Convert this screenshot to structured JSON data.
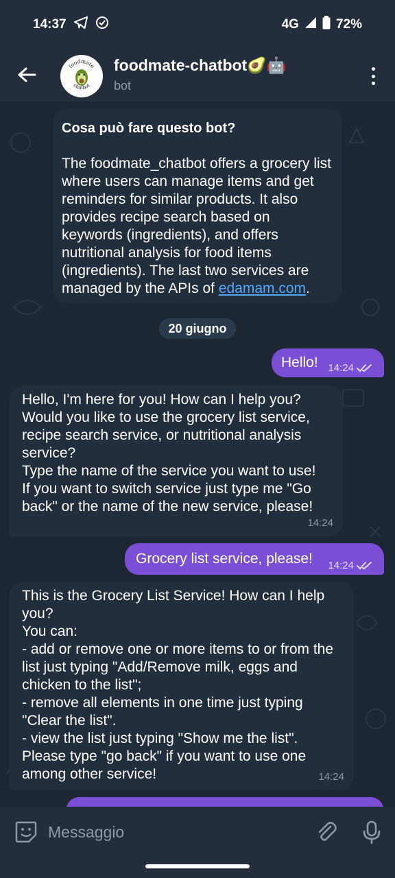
{
  "status_bar": {
    "time": "14:37",
    "network": "4G",
    "battery": "72%",
    "icons": [
      "telegram-icon",
      "check-circle-icon",
      "signal-icon",
      "battery-icon"
    ]
  },
  "header": {
    "title": "foodmate-chatbot🥑🤖",
    "subtitle": "bot",
    "avatar_text_top": "foodmate",
    "avatar_text_bottom": "chatbot"
  },
  "info_card": {
    "title": "Cosa può fare questo bot?",
    "body": "The foodmate_chatbot offers a grocery list where users can manage items and get reminders for similar products. It also provides recipe search based on keywords (ingredients), and offers nutritional analysis for food items (ingredients). The last two services are managed by the APIs of ",
    "link": "edamam.com",
    "after_link": "."
  },
  "date_chip": "20 giugno",
  "messages": [
    {
      "direction": "out",
      "text": "Hello!",
      "time": "14:24"
    },
    {
      "direction": "in",
      "text": "Hello, I'm here for you! How can I help you? Would you like to use the grocery list service, recipe search service, or nutritional analysis service?\nType the name of the service you want to use!\nIf you want to switch service just type me \"Go back\" or the name of the new service, please!",
      "time": "14:24"
    },
    {
      "direction": "out",
      "text": "Grocery list service, please!",
      "time": "14:24"
    },
    {
      "direction": "in",
      "text": "This is the Grocery List Service! How can I help you?\nYou can:\n- add or remove one or more items to or from the list just typing \"Add/Remove milk, eggs and chicken to the list\";\n- remove all elements in one time just typing \"Clear the list\".\n- view the list just typing \"Show me the list\".\nPlease type \"go back\" if you want to use one among other service!",
      "time": "14:24"
    }
  ],
  "input": {
    "placeholder": "Messaggio"
  },
  "colors": {
    "background": "#1d2633",
    "header": "#232d3b",
    "incoming_bubble": "#232e3d",
    "outgoing_bubble": "#7a4fd6",
    "link": "#54a9ff"
  }
}
